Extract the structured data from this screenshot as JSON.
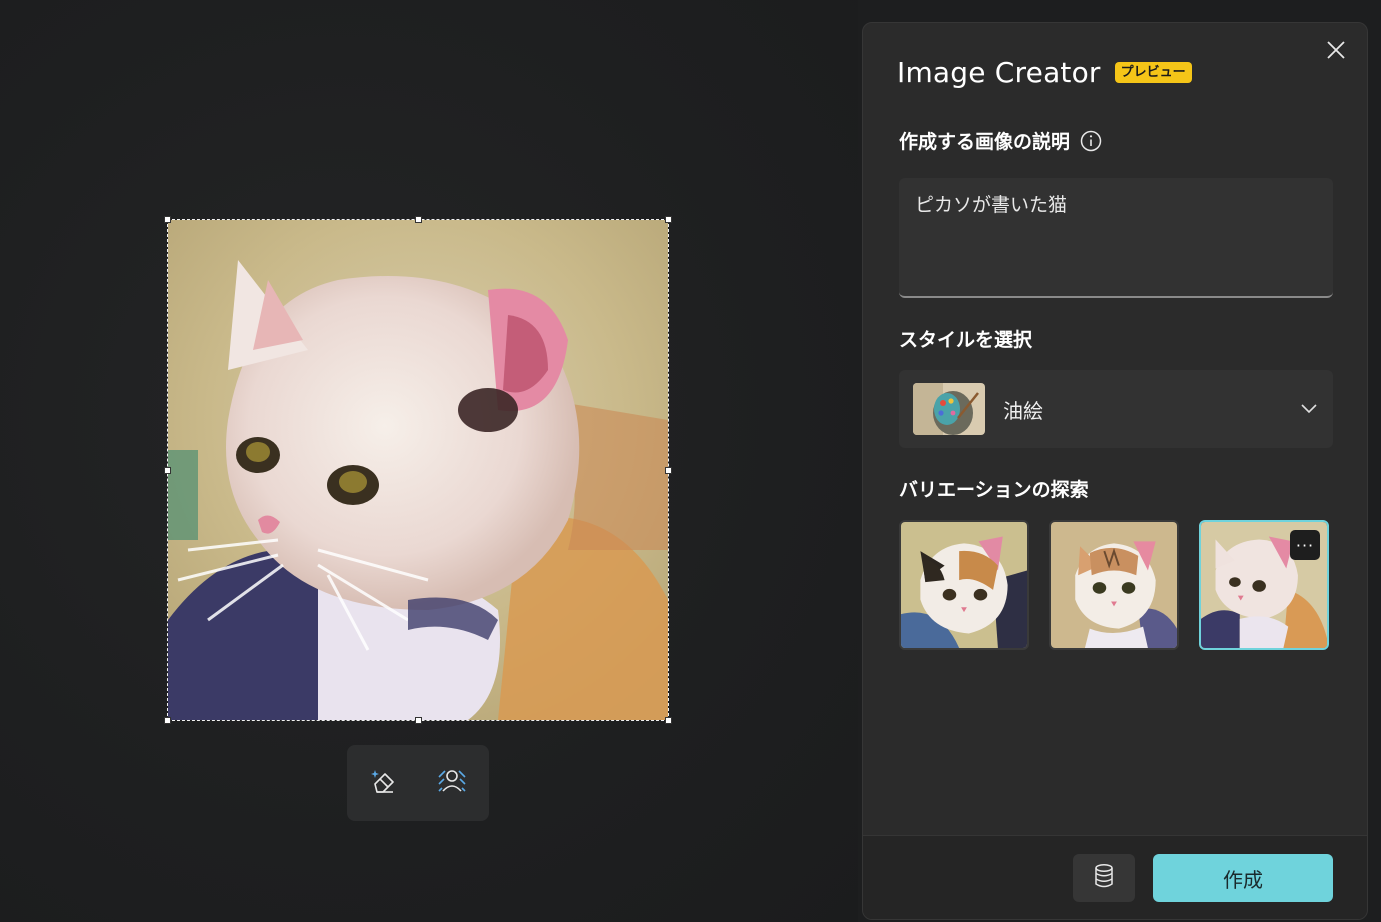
{
  "canvas": {
    "toolbar": {
      "erase_icon": "magic-eraser-icon",
      "remove_bg_icon": "background-remove-icon"
    }
  },
  "panel": {
    "title": "Image Creator",
    "badge": "プレビュー",
    "description_label": "作成する画像の説明",
    "prompt_value": "ピカソが書いた猫",
    "style_label": "スタイルを選択",
    "style_selected": "油絵",
    "variations_label": "バリエーションの探索",
    "variations": [
      {
        "name": "variation-1",
        "selected": false
      },
      {
        "name": "variation-2",
        "selected": false
      },
      {
        "name": "variation-3",
        "selected": true
      }
    ],
    "more_label": "···",
    "create_label": "作成"
  },
  "colors": {
    "accent": "#6fd3dc",
    "badge": "#f5c518",
    "panel_bg": "#2b2b2b",
    "canvas_bg": "#1d1e1f"
  }
}
